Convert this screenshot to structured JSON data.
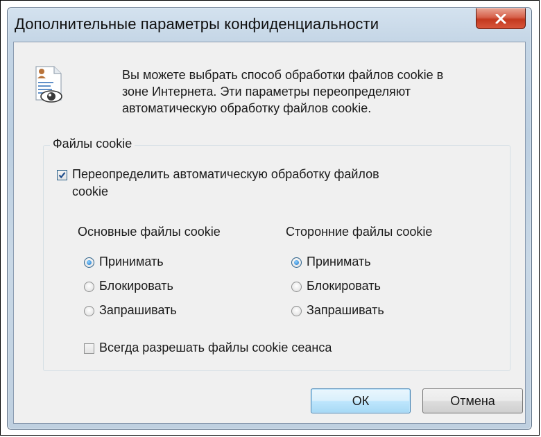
{
  "window": {
    "title": "Дополнительные параметры конфиденциальности",
    "close_label": "x"
  },
  "description": {
    "lines": [
      "Вы можете выбрать способ обработки файлов cookie в",
      "зоне Интернета. Эти параметры переопределяют",
      "автоматическую обработку файлов cookie."
    ],
    "icon": "privacy-document-eye-icon"
  },
  "group": {
    "legend": "Файлы cookie",
    "override": {
      "label_line1": "Переопределить автоматическую обработку файлов",
      "label_line2": "cookie",
      "checked": true
    },
    "first_party": {
      "heading": "Основные файлы cookie",
      "options": [
        "Принимать",
        "Блокировать",
        "Запрашивать"
      ],
      "selected": "Принимать"
    },
    "third_party": {
      "heading": "Сторонние файлы cookie",
      "options": [
        "Принимать",
        "Блокировать",
        "Запрашивать"
      ],
      "selected": "Принимать"
    },
    "session": {
      "label": "Всегда разрешать файлы cookie сеанса",
      "checked": false
    }
  },
  "buttons": {
    "ok": "ОК",
    "cancel": "Отмена"
  },
  "colors": {
    "close_button": "#c3391f",
    "default_button_border": "#3c7fb1",
    "radio_dot": "#1b72c4"
  }
}
